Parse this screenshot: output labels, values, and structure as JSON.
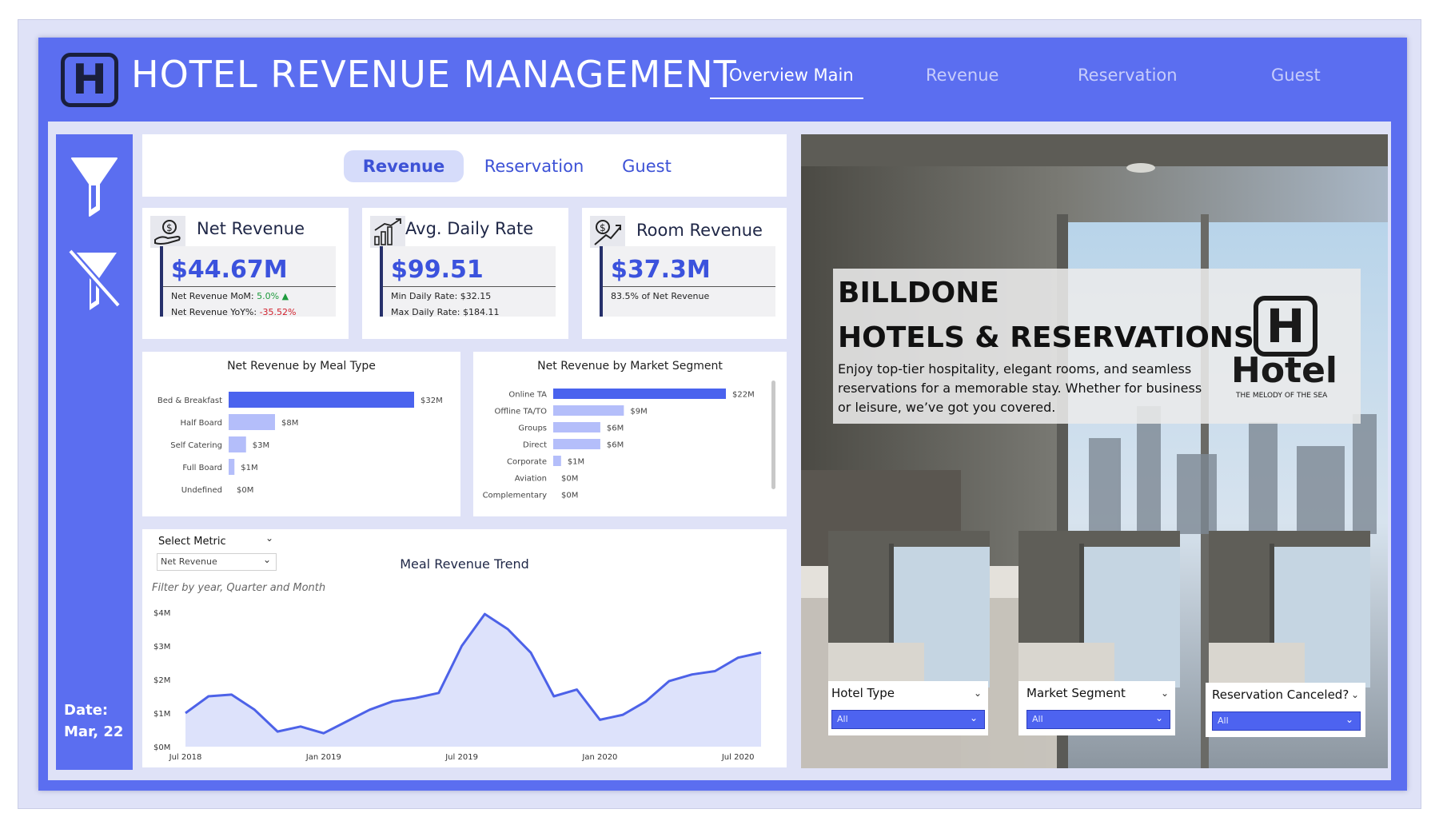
{
  "header": {
    "logo_letter": "H",
    "title": "HOTEL REVENUE MANAGEMENT",
    "tabs": [
      "Overview Main",
      "Revenue",
      "Reservation",
      "Guest"
    ]
  },
  "sidebar": {
    "date_label": "Date:",
    "date_value": "Mar, 22"
  },
  "subtabs": [
    "Revenue",
    "Reservation",
    "Guest"
  ],
  "kpis": {
    "net_revenue": {
      "title": "Net Revenue",
      "value": "$44.67M",
      "mom_label": "Net Revenue MoM:",
      "mom_value": "5.0%",
      "yoy_label": "Net Revenue YoY%:",
      "yoy_value": "-35.52%"
    },
    "adr": {
      "title": "Avg. Daily Rate",
      "value": "$99.51",
      "min_label": "Min Daily Rate: $32.15",
      "max_label": "Max Daily Rate: $184.11"
    },
    "room_revenue": {
      "title": "Room Revenue",
      "value": "$37.3M",
      "share_label": "83.5% of Net Revenue"
    }
  },
  "chart_data": [
    {
      "type": "bar",
      "orientation": "horizontal",
      "title": "Net Revenue by Meal Type",
      "categories": [
        "Bed & Breakfast",
        "Half Board",
        "Self Catering",
        "Full Board",
        "Undefined"
      ],
      "values": [
        32,
        8,
        3,
        1,
        0
      ],
      "labels": [
        "$32M",
        "$8M",
        "$3M",
        "$1M",
        "$0M"
      ],
      "unit": "$M",
      "colors": [
        "#4a63ee",
        "#b4befa",
        "#b4befa",
        "#b4befa",
        "#b4befa"
      ]
    },
    {
      "type": "bar",
      "orientation": "horizontal",
      "title": "Net Revenue by Market Segment",
      "categories": [
        "Online TA",
        "Offline TA/TO",
        "Groups",
        "Direct",
        "Corporate",
        "Aviation",
        "Complementary"
      ],
      "values": [
        22,
        9,
        6,
        6,
        1,
        0,
        0
      ],
      "labels": [
        "$22M",
        "$9M",
        "$6M",
        "$6M",
        "$1M",
        "$0M",
        "$0M"
      ],
      "unit": "$M",
      "colors": [
        "#4a63ee",
        "#b4befa",
        "#b4befa",
        "#b4befa",
        "#b4befa",
        "#b4befa",
        "#b4befa"
      ]
    },
    {
      "type": "area",
      "title": "Meal Revenue Trend",
      "x_tick_labels": [
        "Jul 2018",
        "Jan 2019",
        "Jul 2019",
        "Jan 2020",
        "Jul 2020"
      ],
      "y_tick_labels": [
        "$0M",
        "$1M",
        "$2M",
        "$3M",
        "$4M"
      ],
      "ylim": [
        0,
        4
      ],
      "x": [
        "Jul 2018",
        "Aug 2018",
        "Sep 2018",
        "Oct 2018",
        "Nov 2018",
        "Dec 2018",
        "Jan 2019",
        "Feb 2019",
        "Mar 2019",
        "Apr 2019",
        "May 2019",
        "Jun 2019",
        "Jul 2019",
        "Aug 2019",
        "Sep 2019",
        "Oct 2019",
        "Nov 2019",
        "Dec 2019",
        "Jan 2020",
        "Feb 2020",
        "Mar 2020",
        "Apr 2020",
        "May 2020",
        "Jun 2020",
        "Jul 2020",
        "Aug 2020"
      ],
      "values": [
        1.0,
        1.5,
        1.55,
        1.1,
        0.45,
        0.6,
        0.4,
        0.75,
        1.1,
        1.35,
        1.45,
        1.6,
        3.0,
        3.95,
        3.5,
        2.8,
        1.5,
        1.7,
        0.8,
        0.95,
        1.35,
        1.95,
        2.15,
        2.25,
        2.65,
        2.8
      ],
      "line_color": "#4d62e8",
      "fill_color": "#dde2fb"
    }
  ],
  "trend_controls": {
    "select_metric_label": "Select Metric",
    "metric_value": "Net Revenue",
    "filter_hint": "Filter by year, Quarter and Month"
  },
  "promo": {
    "line1": "BILLDONE",
    "line2": "HOTELS & RESERVATIONS",
    "text": "Enjoy top-tier hospitality, elegant rooms, and seamless reservations for a memorable stay. Whether for business or leisure, we’ve got you covered.",
    "logo_letter": "H",
    "logo_word": "Hotel",
    "logo_tagline": "THE MELODY OF THE SEA"
  },
  "slicers": [
    {
      "label": "Hotel Type",
      "value": "All"
    },
    {
      "label": "Market Segment",
      "value": "All"
    },
    {
      "label": "Reservation Canceled?",
      "value": "All"
    }
  ]
}
